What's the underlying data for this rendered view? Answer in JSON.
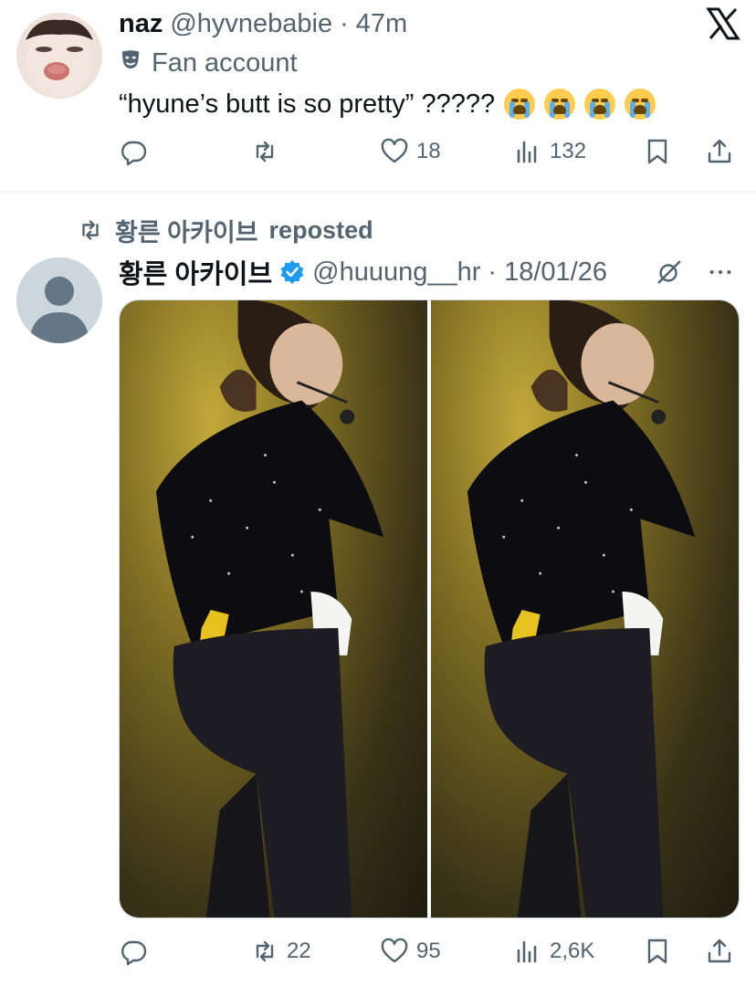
{
  "tweet1": {
    "display_name": "naz",
    "handle": "@hyvnebabie",
    "separator": "·",
    "time": "47m",
    "label": "Fan account",
    "text": "“hyune’s butt is so pretty” ?????",
    "emoji_name": "loudly-crying-face",
    "emoji_count": 4,
    "stats": {
      "replies": "",
      "reposts": "",
      "likes": "18",
      "views": "132"
    }
  },
  "repost_banner": {
    "user": "황른 아카이브",
    "suffix": "reposted"
  },
  "tweet2": {
    "display_name": "황른 아카이브",
    "handle": "@huuung__hr",
    "separator": "·",
    "date": "18/01/26",
    "verified": true,
    "media_count": 2,
    "stats": {
      "replies": "",
      "reposts": "22",
      "likes": "95",
      "views": "2,6K"
    }
  },
  "colors": {
    "muted": "#536471",
    "verified": "#1d9bf0",
    "text": "#0f1419"
  },
  "icons": [
    "x-logo-icon",
    "theater-masks-icon",
    "reply-icon",
    "repost-icon",
    "like-icon",
    "views-icon",
    "bookmark-icon",
    "share-icon",
    "verified-badge-icon",
    "grok-icon",
    "more-icon"
  ]
}
